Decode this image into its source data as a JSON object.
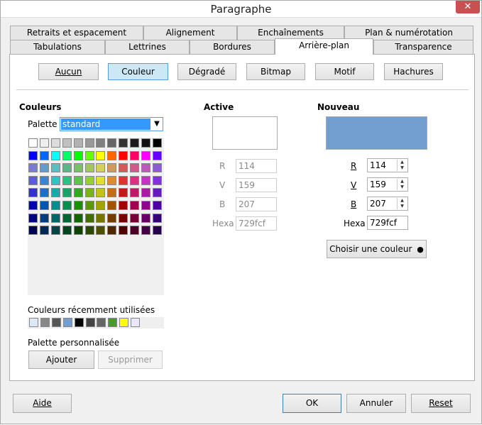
{
  "window": {
    "title": "Paragraphe",
    "close_glyph": "✕"
  },
  "tabs_row1": [
    "Retraits et espacement",
    "Alignement",
    "Enchaînements",
    "Plan & numérotation"
  ],
  "tabs_row2": [
    "Tabulations",
    "Lettrines",
    "Bordures",
    "Arrière-plan",
    "Transparence"
  ],
  "active_tab": "Arrière-plan",
  "fill_buttons": [
    "Aucun",
    "Couleur",
    "Dégradé",
    "Bitmap",
    "Motif",
    "Hachures"
  ],
  "selected_fill": "Couleur",
  "colors_section": {
    "heading": "Couleurs",
    "palette_label": "Palette :",
    "palette_value": "standard",
    "swatches": [
      [
        "#ffffff",
        "#eeeeee",
        "#dddddd",
        "#c0c0c0",
        "#b2b2b2",
        "#999999",
        "#808080",
        "#666666",
        "#333333",
        "#1c1c1c",
        "#111111",
        "#000000"
      ],
      [
        "#0000ff",
        "#0066ff",
        "#00ffff",
        "#00ff66",
        "#00ff00",
        "#66ff00",
        "#ffff00",
        "#ff6600",
        "#ff0000",
        "#ff0066",
        "#ff00ff",
        "#6600ff"
      ],
      [
        "#7b7bd1",
        "#6699cc",
        "#5bbdbd",
        "#5bb78a",
        "#7bbd6b",
        "#a2c55c",
        "#d1d15b",
        "#d19a5b",
        "#d15b5b",
        "#cf5b8b",
        "#bd5bbd",
        "#8b5bcf"
      ],
      [
        "#5c5cd6",
        "#3a85d1",
        "#2fc4c4",
        "#2fbf80",
        "#5cc44a",
        "#94cf33",
        "#dede33",
        "#de8a33",
        "#de3333",
        "#d83380",
        "#c433c4",
        "#8033d8"
      ],
      [
        "#3333cc",
        "#1c6fc6",
        "#1aa8a8",
        "#1aa366",
        "#33a81a",
        "#7ab31a",
        "#c2c21a",
        "#c26d1a",
        "#c21a1a",
        "#bb1a66",
        "#a81aa8",
        "#661abb"
      ],
      [
        "#0000b3",
        "#0055b3",
        "#008f8f",
        "#008f4d",
        "#1a8f00",
        "#5c9900",
        "#a3a300",
        "#a35200",
        "#a30000",
        "#a3004d",
        "#8f008f",
        "#4d00a3"
      ],
      [
        "#000080",
        "#003d80",
        "#006666",
        "#006633",
        "#136600",
        "#426e00",
        "#757500",
        "#753b00",
        "#750000",
        "#750036",
        "#660066",
        "#360075"
      ],
      [
        "#000055",
        "#002855",
        "#004444",
        "#004422",
        "#0d4400",
        "#2c4900",
        "#4e4e00",
        "#4e2700",
        "#4e0000",
        "#4e0024",
        "#440044",
        "#24004e"
      ]
    ],
    "recent_label": "Couleurs récemment utilisées",
    "recent_swatches": [
      "#dde8f5",
      "#888888",
      "#555555",
      "#729fcf",
      "#000000",
      "#444444",
      "#666666",
      "#4a9a2a",
      "#ffff00",
      "#e8e8f8"
    ],
    "custom_label": "Palette personnalisée",
    "add_label": "Ajouter",
    "remove_label": "Supprimer"
  },
  "active_section": {
    "heading": "Active",
    "preview_color": "#ffffff",
    "r_label": "R",
    "r_value": "114",
    "g_label": "V",
    "g_value": "159",
    "b_label": "B",
    "b_value": "207",
    "hex_label": "Hexa",
    "hex_value": "729fcf"
  },
  "new_section": {
    "heading": "Nouveau",
    "preview_color": "#729fcf",
    "r_label": "R",
    "r_value": "114",
    "g_label": "V",
    "g_value": "159",
    "b_label": "B",
    "b_value": "207",
    "hex_label": "Hexa",
    "hex_value": "729fcf",
    "pick_label": "Choisir une couleur",
    "pick_icon": "droplet-icon"
  },
  "footer": {
    "help": "Aide",
    "ok": "OK",
    "cancel": "Annuler",
    "reset": "Reset"
  }
}
